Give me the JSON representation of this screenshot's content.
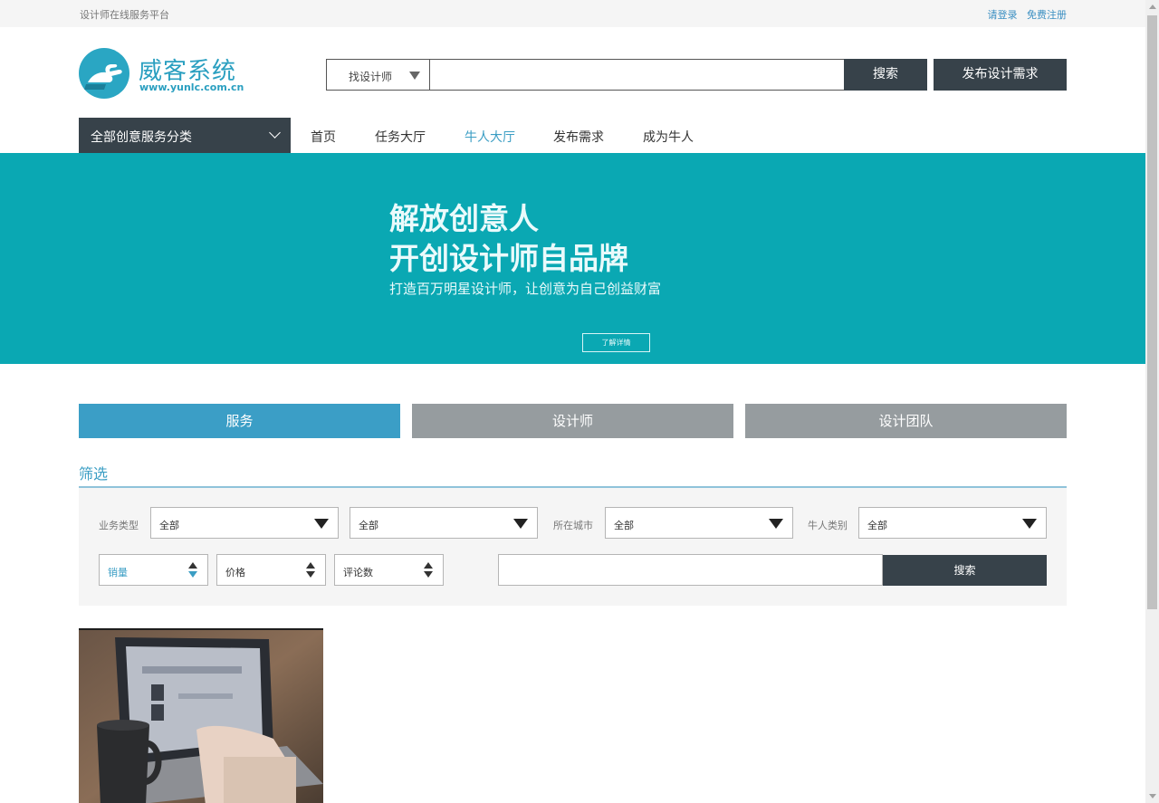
{
  "topbar": {
    "slogan": "设计师在线服务平台",
    "login": "请登录",
    "register": "免费注册"
  },
  "header": {
    "logo_name": "威客系统",
    "logo_url": "www.yunlc.com.cn",
    "search_type": "找设计师",
    "search_value": "",
    "search_button": "搜索",
    "post_button": "发布设计需求"
  },
  "nav": {
    "category": "全部创意服务分类",
    "items": [
      {
        "label": "首页"
      },
      {
        "label": "任务大厅"
      },
      {
        "label": "牛人大厅",
        "active": true
      },
      {
        "label": "发布需求"
      },
      {
        "label": "成为牛人"
      }
    ]
  },
  "banner": {
    "line1": "解放创意人",
    "line2": "开创设计师自品牌",
    "sub": "打造百万明星设计师，让创意为自己创益财富",
    "button": "了解详情"
  },
  "tabs": [
    {
      "label": "服务",
      "active": true
    },
    {
      "label": "设计师"
    },
    {
      "label": "设计团队"
    }
  ],
  "filter": {
    "title": "筛选",
    "business_label": "业务类型",
    "business_value": "全部",
    "business_sub_value": "全部",
    "city_label": "所在城市",
    "city_value": "全部",
    "expert_label": "牛人类别",
    "expert_value": "全部",
    "sort": [
      {
        "label": "销量",
        "active": true
      },
      {
        "label": "价格"
      },
      {
        "label": "评论数"
      }
    ],
    "keyword_value": "",
    "search_button": "搜索"
  },
  "colors": {
    "accent": "#3b9ec4",
    "banner": "#0aa8b3",
    "dark_button": "#37424a",
    "inactive_tab": "#969c9f"
  }
}
